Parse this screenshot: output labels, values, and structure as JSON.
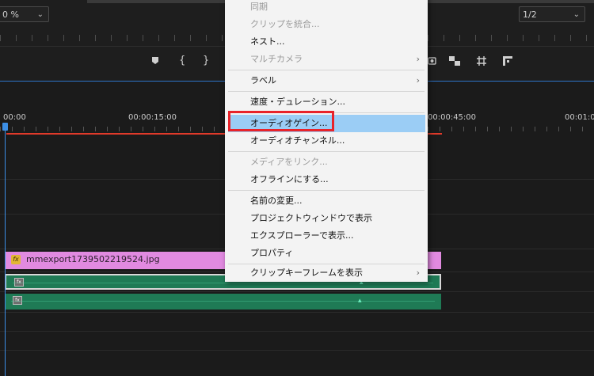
{
  "monitor": {
    "zoom_label": "0 %",
    "resolution_label": "1/2"
  },
  "timecodes": [
    "00:00",
    "00:00:15:00",
    "00:00:45:00",
    "00:01:0"
  ],
  "clips": {
    "video_name": "mmexport1739502219524.jpg",
    "video_fx": "fx",
    "audio_fx": "fx"
  },
  "context_menu": {
    "items": [
      {
        "label": "同期",
        "disabled": true
      },
      {
        "label": "クリップを統合...",
        "disabled": true
      },
      {
        "label": "ネスト...",
        "disabled": false
      },
      {
        "label": "マルチカメラ",
        "disabled": true,
        "submenu": true
      },
      {
        "label": "ラベル",
        "disabled": false,
        "submenu": true
      },
      {
        "label": "速度・デュレーション...",
        "disabled": false
      },
      {
        "label": "オーディオゲイン...",
        "disabled": false,
        "highlighted": true
      },
      {
        "label": "オーディオチャンネル...",
        "disabled": false
      },
      {
        "label": "メディアをリンク...",
        "disabled": true
      },
      {
        "label": "オフラインにする...",
        "disabled": false
      },
      {
        "label": "名前の変更...",
        "disabled": false
      },
      {
        "label": "プロジェクトウィンドウで表示",
        "disabled": false
      },
      {
        "label": "エクスプローラーで表示...",
        "disabled": false
      },
      {
        "label": "プロパティ",
        "disabled": false
      },
      {
        "label": "クリップキーフレームを表示",
        "disabled": false,
        "submenu": true
      }
    ],
    "submenu_arrow": "›"
  },
  "colors": {
    "highlight": "#9bcdf5",
    "annotation_box": "#e8232a",
    "video_clip": "#e18ae0",
    "audio_clip": "#1f7a55",
    "playhead": "#3c8fe6"
  }
}
